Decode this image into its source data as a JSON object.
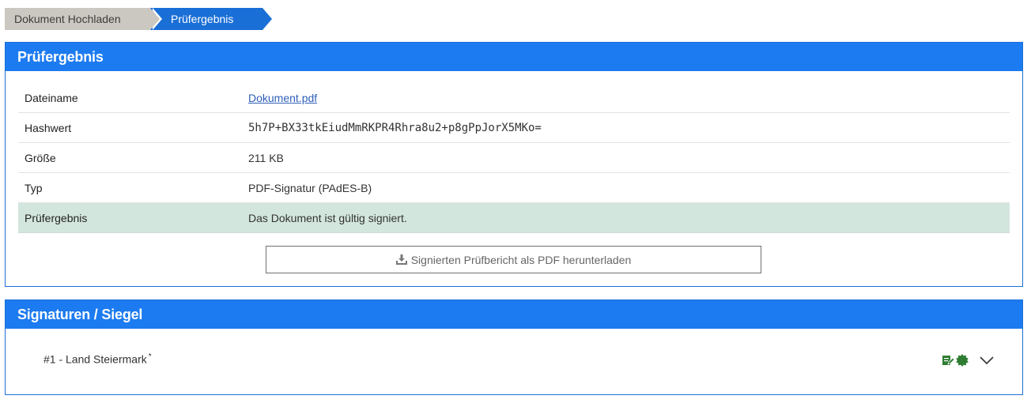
{
  "breadcrumb": {
    "step1": "Dokument Hochladen",
    "step2": "Prüfergebnis"
  },
  "result_panel": {
    "title": "Prüfergebnis",
    "rows": [
      {
        "label": "Dateiname",
        "value": "Dokument.pdf"
      },
      {
        "label": "Hashwert",
        "value": "5h7P+BX33tkEiudMmRKPR4Rhra8u2+p8gPpJorX5MKo="
      },
      {
        "label": "Größe",
        "value": "211 KB"
      },
      {
        "label": "Typ",
        "value": "PDF-Signatur (PAdES-B)"
      },
      {
        "label": "Prüfergebnis",
        "value": "Das Dokument ist gültig signiert."
      }
    ],
    "download_button": "Signierten Prüfbericht als PDF herunterladen"
  },
  "signatures_panel": {
    "title": "Signaturen / Siegel",
    "items": [
      {
        "label": "#1 - Land Steiermark",
        "marker": "*"
      }
    ],
    "icons": [
      "signature-edit-icon",
      "seal-badge-icon",
      "chevron-down-icon"
    ]
  },
  "colors": {
    "primary": "#1c7bf0",
    "breadcrumb_inactive": "#cbc8c1",
    "result_row": "#d3e6de",
    "icon_green": "#2e7d32"
  }
}
